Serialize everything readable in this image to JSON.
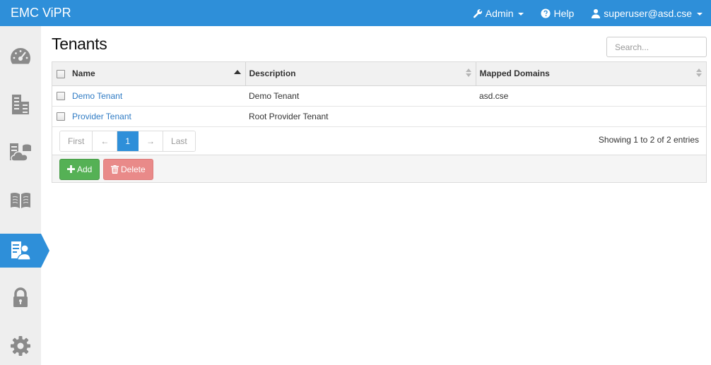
{
  "app": {
    "brand": "EMC ViPR"
  },
  "topnav": {
    "admin_label": "Admin",
    "help_label": "Help",
    "user_label": "superuser@asd.cse"
  },
  "sidebar": {
    "items": [
      {
        "name": "dashboard",
        "icon": "dashboard-icon",
        "active": false
      },
      {
        "name": "physical-assets",
        "icon": "building-icon",
        "active": false
      },
      {
        "name": "virtual-assets",
        "icon": "cloud-storage-icon",
        "active": false
      },
      {
        "name": "catalog",
        "icon": "book-icon",
        "active": false
      },
      {
        "name": "tenants",
        "icon": "tenant-icon",
        "active": true
      },
      {
        "name": "security",
        "icon": "lock-icon",
        "active": false
      },
      {
        "name": "settings",
        "icon": "gear-icon",
        "active": false
      }
    ]
  },
  "page": {
    "title": "Tenants",
    "search_placeholder": "Search..."
  },
  "table": {
    "columns": [
      "Name",
      "Description",
      "Mapped Domains"
    ],
    "rows": [
      {
        "name": "Demo Tenant",
        "description": "Demo Tenant",
        "domains": "asd.cse"
      },
      {
        "name": "Provider Tenant",
        "description": "Root Provider Tenant",
        "domains": ""
      }
    ]
  },
  "pagination": {
    "first": "First",
    "prev": "←",
    "current": "1",
    "next": "→",
    "last": "Last",
    "info": "Showing 1 to 2 of 2 entries"
  },
  "actions": {
    "add_label": "Add",
    "delete_label": "Delete"
  },
  "colors": {
    "topbar": "#2e8fd9",
    "sidebar": "#eeeeee",
    "link": "#2f7bc4",
    "add_button": "#55b155",
    "delete_button": "#e98a89"
  }
}
